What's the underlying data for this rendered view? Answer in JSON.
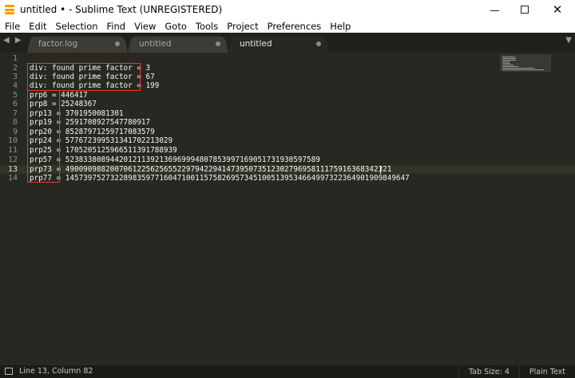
{
  "window": {
    "title": "untitled • - Sublime Text (UNREGISTERED)",
    "controls": {
      "minimize": "minimize",
      "maximize": "maximize",
      "close": "✕"
    }
  },
  "menu": [
    "File",
    "Edit",
    "Selection",
    "Find",
    "View",
    "Goto",
    "Tools",
    "Project",
    "Preferences",
    "Help"
  ],
  "tabs": [
    {
      "label": "factor.log",
      "active": false
    },
    {
      "label": "untitled",
      "active": false
    },
    {
      "label": "untitled",
      "active": true
    }
  ],
  "editor": {
    "current_line": 13,
    "lines": [
      {
        "num": "1",
        "text": ""
      },
      {
        "num": "2",
        "text": "div: found prime factor = 3"
      },
      {
        "num": "3",
        "text": "div: found prime factor = 67"
      },
      {
        "num": "4",
        "text": "div: found prime factor = 199"
      },
      {
        "num": "5",
        "text": "prp6 = 446417"
      },
      {
        "num": "6",
        "text": "prp8 = 25248367"
      },
      {
        "num": "7",
        "text": "prp13 = 3701950081301"
      },
      {
        "num": "8",
        "text": "prp19 = 2591708927547780917"
      },
      {
        "num": "9",
        "text": "prp20 = 85287971259717083579"
      },
      {
        "num": "10",
        "text": "prp24 = 577672399531341702213029"
      },
      {
        "num": "11",
        "text": "prp25 = 1705205125966511391788939"
      },
      {
        "num": "12",
        "text": "prp57 = 523833808944201211392136969994807853997169051731930597589"
      },
      {
        "num": "13",
        "text": "prp73 = 4900909882007061225625655229794229414739507351230279695811175916368342321"
      },
      {
        "num": "14",
        "text": "prp77 = 14573975273228983597716047100115758269573451005139534664997322364901909849647"
      }
    ]
  },
  "colors": {
    "editor_bg": "#272822",
    "tabbar_bg": "#1f211c",
    "text": "#f8f8f2",
    "highlight_box": "#e53935",
    "status_bg": "#1b1c18"
  },
  "status": {
    "position": "Line 13, Column 82",
    "tab_size": "Tab Size: 4",
    "syntax": "Plain Text"
  }
}
